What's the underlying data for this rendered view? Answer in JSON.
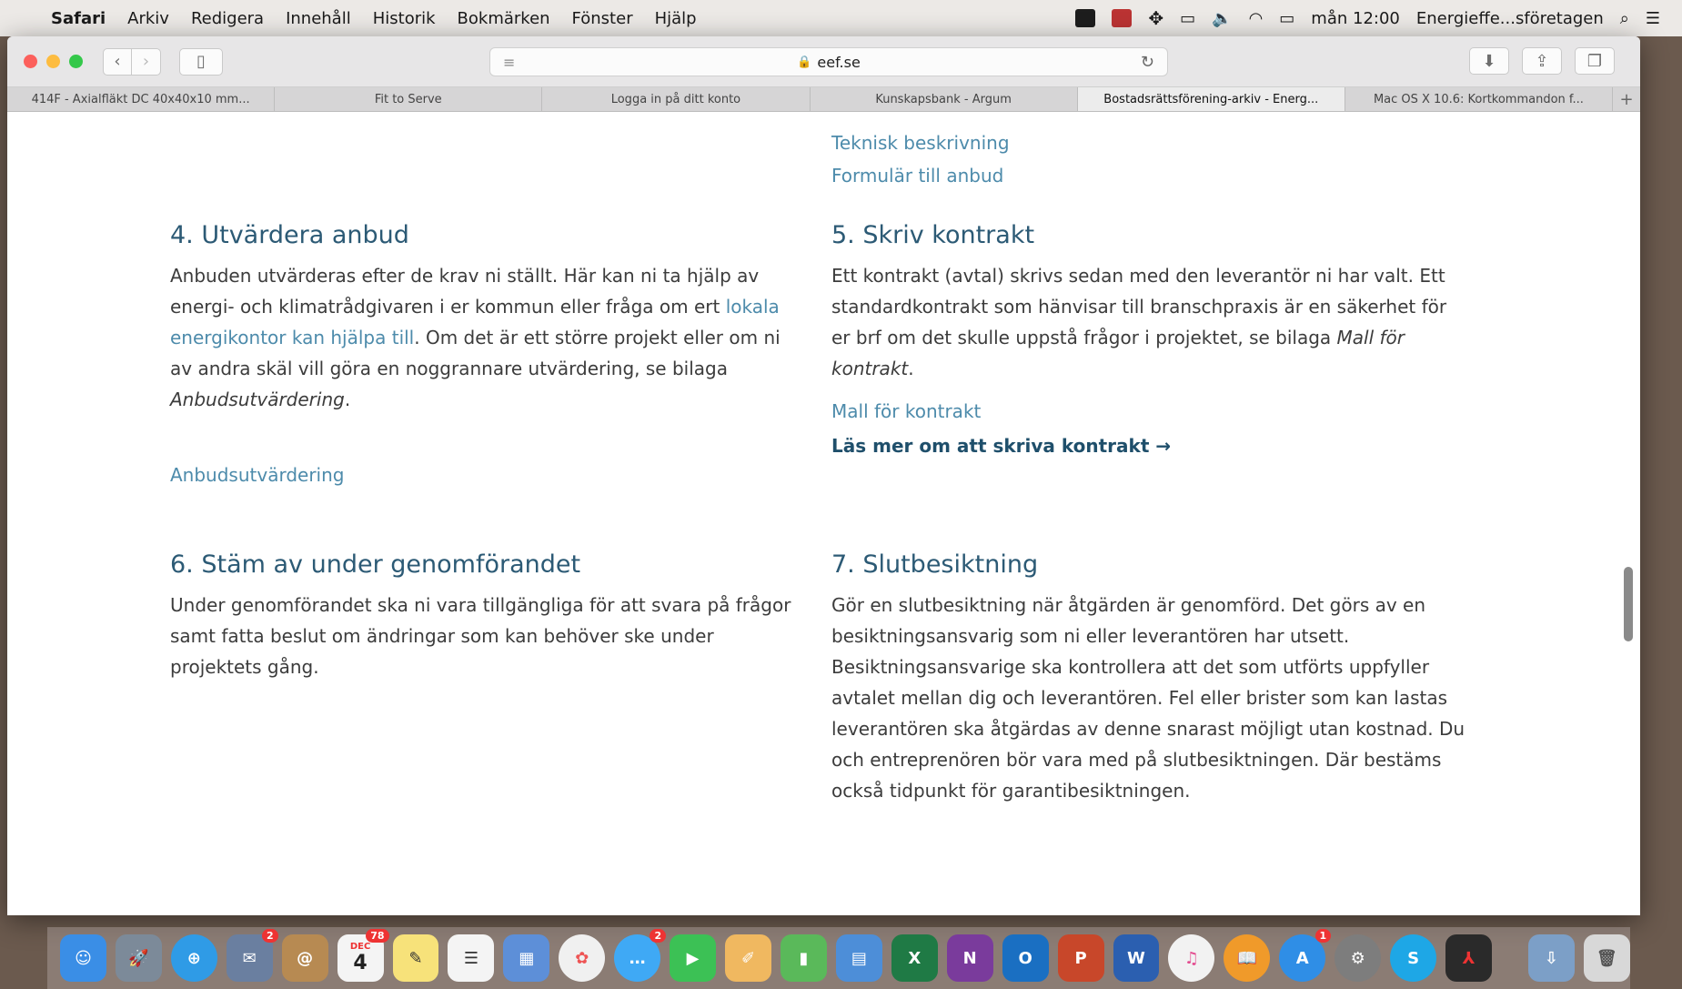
{
  "menubar": {
    "app": "Safari",
    "items": [
      "Arkiv",
      "Redigera",
      "Innehåll",
      "Historik",
      "Bokmärken",
      "Fönster",
      "Hjälp"
    ],
    "clock": "mån 12:00",
    "user": "Energieffe...sföretagen"
  },
  "browser": {
    "url": "eef.se",
    "tabs": [
      "414F - Axialfläkt DC 40x40x10 mm...",
      "Fit to Serve",
      "Logga in på ditt konto",
      "Kunskapsbank - Argum",
      "Bostadsrättsförening-arkiv - Energ...",
      "Mac OS X 10.6: Kortkommandon f..."
    ]
  },
  "content": {
    "top_links": [
      "Teknisk beskrivning",
      "Formulär till anbud"
    ],
    "step4": {
      "title": "4. Utvärdera anbud",
      "text_a": "Anbuden utvärderas efter de krav ni ställt. Här kan ni ta hjälp av energi- och klimatrådgivaren i er kommun eller fråga om ert ",
      "link": "lokala energikontor kan hjälpa till",
      "text_b": ". Om det är ett större projekt eller om ni av andra skäl vill göra en noggrannare utvärdering, se bilaga ",
      "text_em": "Anbudsutvärdering",
      "text_c": ".",
      "attachment": "Anbudsutvärdering"
    },
    "step5": {
      "title": "5. Skriv kontrakt",
      "text_a": "Ett kontrakt (avtal) skrivs sedan med den leverantör ni har valt. Ett standardkontrakt som hänvisar till branschpraxis är en säkerhet för er brf om det skulle uppstå frågor i projektet, se bilaga ",
      "text_em": "Mall för kontrakt",
      "text_c": ".",
      "attachment": "Mall för kontrakt",
      "read_more": "Läs mer om att skriva kontrakt →"
    },
    "step6": {
      "title": "6. Stäm av under genomförandet",
      "text": "Under genomförandet ska ni vara tillgängliga för att svara på frågor samt fatta beslut om ändringar som kan behöver ske under projektets gång."
    },
    "step7": {
      "title": "7. Slutbesiktning",
      "text": "Gör en slutbesiktning när åtgärden är genomförd. Det görs av en besiktningsansvarig som ni eller leverantören har utsett. Besiktningsansvarige ska kontrollera att det som utförts uppfyller avtalet mellan dig och leverantören. Fel eller brister som kan lastas leverantören ska åtgärdas av denne snarast möjligt utan kostnad. Du och entreprenören bör vara med på slutbesiktningen. Där bestäms också tidpunkt för garantibesiktningen."
    }
  },
  "dock": {
    "calendar_month": "DEC",
    "calendar_day": "4",
    "calendar_badge": "78",
    "mail_badge": "2",
    "messages_badge": "2",
    "appstore_badge": "1"
  }
}
